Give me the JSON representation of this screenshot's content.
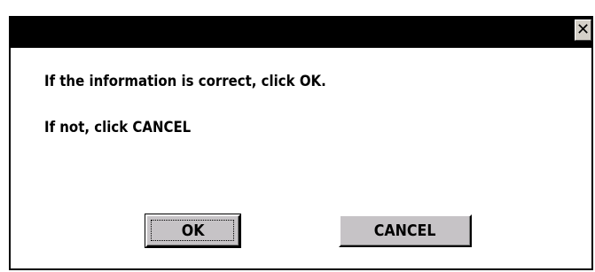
{
  "dialog": {
    "close_glyph": "✕",
    "message_line1": "If the information is correct, click OK.",
    "message_line2": "If not, click CANCEL",
    "ok_label": "OK",
    "cancel_label": "CANCEL"
  },
  "colors": {
    "titlebar": "#000000",
    "button_face": "#c6c3c6",
    "background": "#ffffff"
  }
}
